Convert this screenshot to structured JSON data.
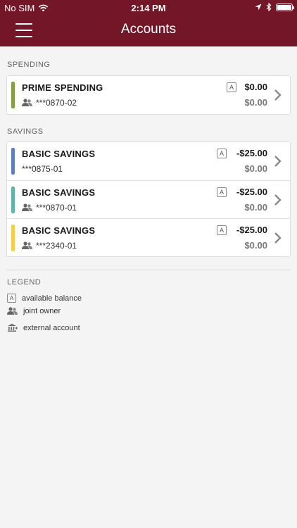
{
  "status": {
    "carrier": "No SIM",
    "time": "2:14 PM"
  },
  "header": {
    "title": "Accounts"
  },
  "sections": {
    "spending": {
      "label": "SPENDING"
    },
    "savings": {
      "label": "SAVINGS"
    }
  },
  "accounts": [
    {
      "name": "PRIME SPENDING",
      "number": "***0870-02",
      "amount": "$0.00",
      "available": "$0.00",
      "joint": true,
      "color": "#7fa043"
    },
    {
      "name": "BASIC SAVINGS",
      "number": "***0875-01",
      "amount": "-$25.00",
      "available": "$0.00",
      "joint": false,
      "color": "#5b7fbf"
    },
    {
      "name": "BASIC SAVINGS",
      "number": "***0870-01",
      "amount": "-$25.00",
      "available": "$0.00",
      "joint": true,
      "color": "#5fb3a7"
    },
    {
      "name": "BASIC SAVINGS",
      "number": "***2340-01",
      "amount": "-$25.00",
      "available": "$0.00",
      "joint": true,
      "color": "#f2ce4a"
    }
  ],
  "badge_letter": "A",
  "legend": {
    "title": "LEGEND",
    "available": "available balance",
    "joint": "joint owner",
    "external": "external account"
  },
  "colors": {
    "header": "#731627",
    "background": "#f4f4f4"
  },
  "icons": {
    "menu": "hamburger-icon",
    "joint": "joint-owner-icon",
    "external": "bank-icon",
    "chevron": "chevron-right-icon"
  }
}
